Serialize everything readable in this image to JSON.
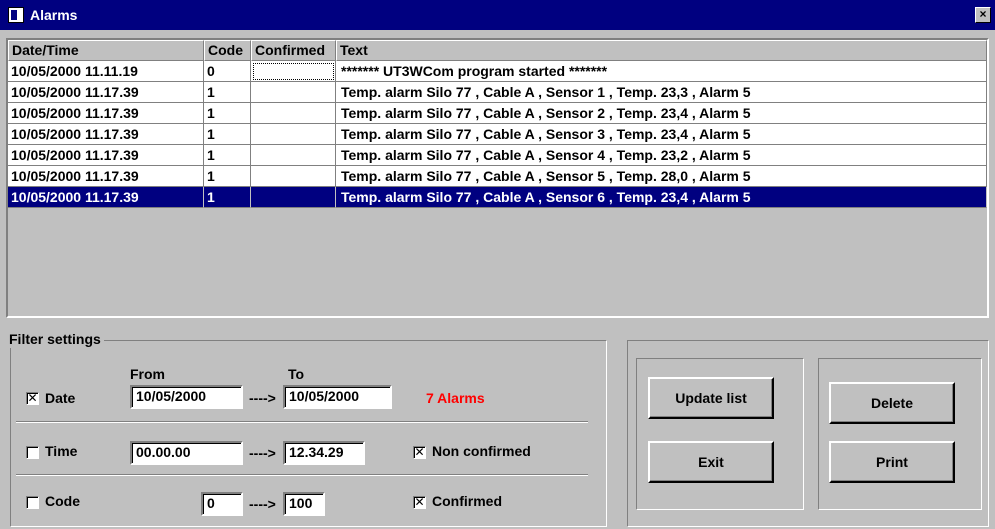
{
  "window": {
    "title": "Alarms",
    "close_glyph": "×"
  },
  "list": {
    "columns": [
      "Date/Time",
      "Code",
      "Confirmed",
      "Text"
    ],
    "rows": [
      {
        "datetime": "10/05/2000 11.11.19",
        "code": "0",
        "confirmed": "",
        "text": "*******  UT3WCom program started  *******"
      },
      {
        "datetime": "10/05/2000 11.17.39",
        "code": "1",
        "confirmed": "",
        "text": "Temp. alarm Silo 77 , Cable A , Sensor 1 , Temp.  23,3 , Alarm 5"
      },
      {
        "datetime": "10/05/2000 11.17.39",
        "code": "1",
        "confirmed": "",
        "text": "Temp. alarm Silo 77 , Cable A , Sensor 2 , Temp.  23,4 , Alarm 5"
      },
      {
        "datetime": "10/05/2000 11.17.39",
        "code": "1",
        "confirmed": "",
        "text": "Temp. alarm Silo 77 , Cable A , Sensor 3 , Temp.  23,4 , Alarm 5"
      },
      {
        "datetime": "10/05/2000 11.17.39",
        "code": "1",
        "confirmed": "",
        "text": "Temp. alarm Silo 77 , Cable A , Sensor 4 , Temp.  23,2 , Alarm 5"
      },
      {
        "datetime": "10/05/2000 11.17.39",
        "code": "1",
        "confirmed": "",
        "text": "Temp. alarm Silo 77 , Cable A , Sensor 5 , Temp.  28,0 , Alarm 5"
      },
      {
        "datetime": "10/05/2000 11.17.39",
        "code": "1",
        "confirmed": "",
        "text": "Temp. alarm Silo 77 , Cable A , Sensor 6 , Temp.  23,4 , Alarm 5"
      }
    ],
    "selected_row": 6
  },
  "filter": {
    "title": "Filter settings",
    "from_label": "From",
    "to_label": "To",
    "arrow": "---->",
    "date": {
      "label": "Date",
      "checked": true,
      "check_glyph": "✕",
      "from": "10/05/2000",
      "to": "10/05/2000"
    },
    "time": {
      "label": "Time",
      "checked": false,
      "check_glyph": "",
      "from": "00.00.00",
      "to": "12.34.29"
    },
    "code": {
      "label": "Code",
      "checked": false,
      "check_glyph": "",
      "from": "0",
      "to": "100"
    },
    "alarms_count": "7  Alarms",
    "non_confirmed": {
      "label": "Non confirmed",
      "checked": true,
      "check_glyph": "✕"
    },
    "confirmed": {
      "label": "Confirmed",
      "checked": true,
      "check_glyph": "✕"
    }
  },
  "buttons": {
    "update": "Update list",
    "exit": "Exit",
    "delete": "Delete",
    "print": "Print"
  },
  "colors": {
    "titlebar": "#000080",
    "selection": "#000080",
    "alarm_count": "#ff0000",
    "face": "#c0c0c0"
  }
}
